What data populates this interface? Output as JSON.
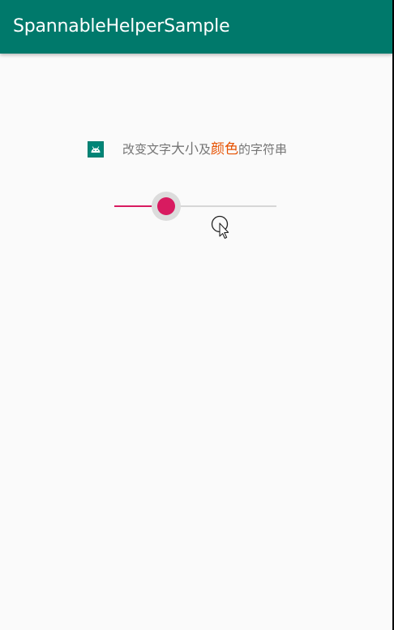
{
  "app_bar": {
    "title": "SpannableHelperSample",
    "background": "#00796b"
  },
  "content": {
    "icon": "android-launcher-icon",
    "spannable_text": {
      "segments": [
        {
          "text": "改变文字",
          "style": "normal"
        },
        {
          "text": "大小",
          "style": "large"
        },
        {
          "text": "及",
          "style": "normal"
        },
        {
          "text": "颜色",
          "style": "large-accent"
        },
        {
          "text": "的字符串",
          "style": "normal"
        }
      ],
      "text_color": "#757575",
      "accent_color": "#e65100"
    },
    "seekbar": {
      "progress_percent": 32,
      "accent_color": "#d81b60",
      "state": "pressed"
    }
  },
  "cursor": {
    "icon": "pointer-cursor-icon"
  }
}
